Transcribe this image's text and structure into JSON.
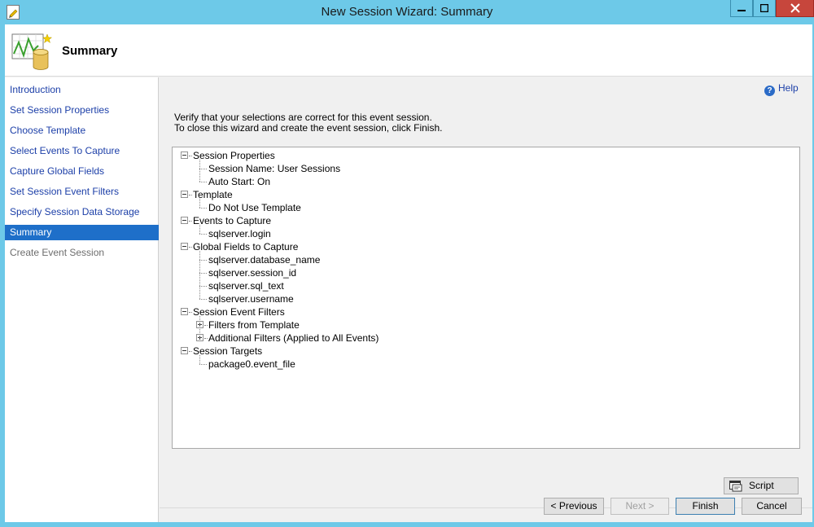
{
  "window": {
    "title": "New Session Wizard: Summary"
  },
  "header": {
    "title": "Summary"
  },
  "sidebar": {
    "items": [
      {
        "label": "Introduction",
        "state": "link"
      },
      {
        "label": "Set Session Properties",
        "state": "link"
      },
      {
        "label": "Choose Template",
        "state": "link"
      },
      {
        "label": "Select Events To Capture",
        "state": "link"
      },
      {
        "label": "Capture Global Fields",
        "state": "link"
      },
      {
        "label": "Set Session Event Filters",
        "state": "link"
      },
      {
        "label": "Specify Session Data Storage",
        "state": "link"
      },
      {
        "label": "Summary",
        "state": "selected"
      },
      {
        "label": "Create Event Session",
        "state": "disabled"
      }
    ]
  },
  "help": {
    "label": "Help"
  },
  "instructions": {
    "line1": "Verify that your selections are correct for this event session.",
    "line2": "To close this wizard and create the event session, click Finish."
  },
  "tree": {
    "nodes": [
      {
        "label": "Session Properties",
        "level": 0,
        "toggle": "minus"
      },
      {
        "label": "Session Name: User Sessions",
        "level": 1,
        "toggle": "none"
      },
      {
        "label": "Auto Start: On",
        "level": 1,
        "toggle": "none"
      },
      {
        "label": "Template",
        "level": 0,
        "toggle": "minus"
      },
      {
        "label": "Do Not Use Template",
        "level": 1,
        "toggle": "none"
      },
      {
        "label": "Events to Capture",
        "level": 0,
        "toggle": "minus"
      },
      {
        "label": "sqlserver.login",
        "level": 1,
        "toggle": "none"
      },
      {
        "label": "Global Fields to Capture",
        "level": 0,
        "toggle": "minus"
      },
      {
        "label": "sqlserver.database_name",
        "level": 1,
        "toggle": "none"
      },
      {
        "label": "sqlserver.session_id",
        "level": 1,
        "toggle": "none"
      },
      {
        "label": "sqlserver.sql_text",
        "level": 1,
        "toggle": "none"
      },
      {
        "label": "sqlserver.username",
        "level": 1,
        "toggle": "none"
      },
      {
        "label": "Session Event Filters",
        "level": 0,
        "toggle": "minus"
      },
      {
        "label": "Filters from Template",
        "level": 1,
        "toggle": "plus"
      },
      {
        "label": "Additional Filters (Applied to All Events)",
        "level": 1,
        "toggle": "plus"
      },
      {
        "label": "Session Targets",
        "level": 0,
        "toggle": "minus"
      },
      {
        "label": "package0.event_file",
        "level": 1,
        "toggle": "none"
      }
    ]
  },
  "buttons": {
    "script": "Script",
    "previous": "< Previous",
    "next": "Next >",
    "finish": "Finish",
    "cancel": "Cancel"
  },
  "icons": {
    "app": "wizard-doc-icon",
    "header": "chart-database-icon",
    "help": "help-icon",
    "script": "script-icon"
  },
  "colors": {
    "titlebar": "#6dc9e8",
    "selection": "#1e6fc9",
    "link": "#1c3fa8",
    "close": "#c7463c"
  }
}
